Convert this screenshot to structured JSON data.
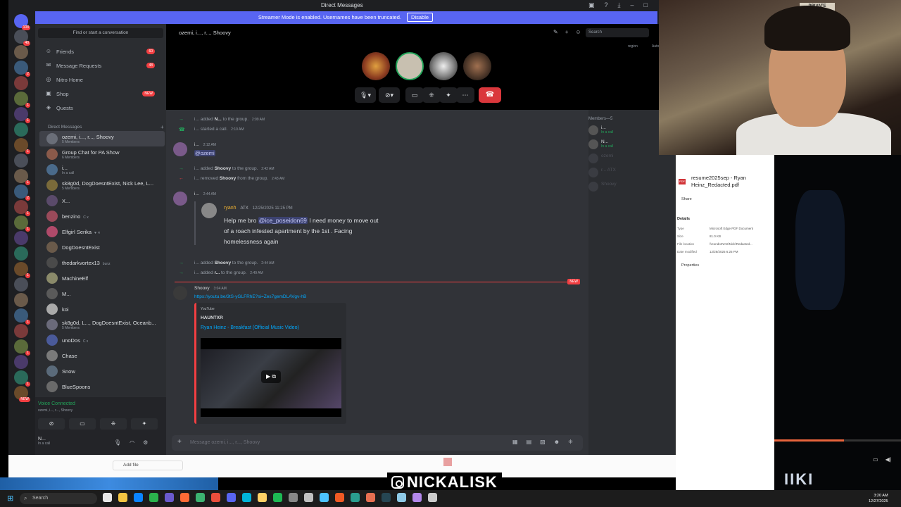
{
  "window": {
    "title": "Direct Messages",
    "streamer_banner": "Streamer Mode is enabled. Usernames have been truncated.",
    "disable_label": "Disable"
  },
  "rail": {
    "home_badge": "108",
    "servers": [
      {
        "badge": "48"
      },
      {
        "badge": ""
      },
      {
        "badge": "2"
      },
      {
        "badge": ""
      },
      {
        "badge": "1"
      },
      {
        "badge": "1"
      },
      {
        "badge": ""
      },
      {
        "badge": "1"
      },
      {
        "badge": ""
      },
      {
        "badge": "1"
      },
      {
        "badge": "2"
      },
      {
        "badge": "1"
      },
      {
        "badge": "1"
      },
      {
        "badge": ""
      },
      {
        "badge": ""
      },
      {
        "badge": "1"
      },
      {
        "badge": ""
      },
      {
        "badge": ""
      },
      {
        "badge": "1"
      },
      {
        "badge": ""
      },
      {
        "badge": "1"
      },
      {
        "badge": ""
      },
      {
        "badge": "1"
      },
      {
        "badge": "NEW"
      }
    ]
  },
  "sidebar": {
    "find_placeholder": "Find or start a conversation",
    "nav": [
      {
        "label": "Friends",
        "badge": "60",
        "icon": "friends-icon"
      },
      {
        "label": "Message Requests",
        "badge": "48",
        "icon": "envelope-icon"
      },
      {
        "label": "Nitro Home",
        "badge": "",
        "icon": "nitro-icon"
      },
      {
        "label": "Shop",
        "badge": "NEW",
        "icon": "shop-icon"
      },
      {
        "label": "Quests",
        "badge": "",
        "icon": "quests-icon"
      }
    ],
    "dm_header": "Direct Messages",
    "dms": [
      {
        "name": "ozemi, i..., r..., Shoovy",
        "sub": "5 Members",
        "tag": ""
      },
      {
        "name": "Group Chat for PA Show",
        "sub": "6 Members",
        "tag": ""
      },
      {
        "name": "i...",
        "sub": "In a call",
        "tag": ""
      },
      {
        "name": "sk8g0d, DogDoesntExist, Nick Lee, L...",
        "sub": "5 Members",
        "tag": ""
      },
      {
        "name": "X...",
        "sub": "",
        "tag": ""
      },
      {
        "name": "benzino",
        "sub": "",
        "tag": "C x"
      },
      {
        "name": "Elfgirl Serika",
        "sub": "",
        "tag": "♥ ✕"
      },
      {
        "name": "DogDoesntExist",
        "sub": "",
        "tag": ""
      },
      {
        "name": "thedarkvortex13",
        "sub": "",
        "tag": "bunz"
      },
      {
        "name": "MachineElf",
        "sub": "",
        "tag": ""
      },
      {
        "name": "M...",
        "sub": "",
        "tag": ""
      },
      {
        "name": "koi",
        "sub": "",
        "tag": ""
      },
      {
        "name": "sk8g0d, L..., DogDoesntExist, Oceanb...",
        "sub": "5 Members",
        "tag": ""
      },
      {
        "name": "unoDos",
        "sub": "",
        "tag": "C x"
      },
      {
        "name": "Chase",
        "sub": "",
        "tag": ""
      },
      {
        "name": "Snow",
        "sub": "",
        "tag": ""
      },
      {
        "name": "BlueSpoons",
        "sub": "",
        "tag": ""
      }
    ],
    "voice": {
      "status": "Voice Connected",
      "channel": "ozemi, i..., r..., Shoovy"
    },
    "user": {
      "name": "N...",
      "status": "In a call"
    }
  },
  "chat": {
    "title": "ozemi, i..., r..., Shoovy",
    "search_placeholder": "Search",
    "region_label": "region",
    "auto_label": "Autom",
    "composer_placeholder": "Message ozemi, i..., r..., Shoovy",
    "messages": {
      "sys1": {
        "actor": "i...",
        "text": "added",
        "target": "N...",
        "rest": "to the group.",
        "time": "2:09 AM"
      },
      "sys2": {
        "actor": "i...",
        "text": "started a call.",
        "time": "2:10 AM"
      },
      "m1": {
        "author": "i...",
        "time": "2:12 AM",
        "mention": "@ozemi"
      },
      "sys3": {
        "actor": "i...",
        "text": "added",
        "target": "Shoovy",
        "rest": "to the group.",
        "time": "2:42 AM"
      },
      "sys4": {
        "actor": "i...",
        "text": "removed",
        "target": "Shoovy",
        "rest": "from the group.",
        "time": "2:43 AM"
      },
      "m2": {
        "author": "i...",
        "time": "2:44 AM"
      },
      "forward": {
        "name": "ryanh",
        "tag": "ATX",
        "date": "12/25/2025 11:25 PM",
        "text_pre": "Help me bro",
        "mention": "@ice_poseidon69",
        "text_post": "I need money to move out of a roach infested apartment by the 1st . Facing homelessness again"
      },
      "sys5": {
        "actor": "i...",
        "text": "added",
        "target": "Shoovy",
        "rest": "to the group.",
        "time": "2:44 AM"
      },
      "sys6": {
        "actor": "i...",
        "text": "added",
        "target": "r...",
        "rest": "to the group.",
        "time": "2:49 AM"
      },
      "new_label": "NEW",
      "m3": {
        "author": "Shoovy",
        "time": "3:04 AM",
        "link": "https://youtu.be/3tS-yGLFRhE?si=Zes7gemDLAVgv-hB",
        "embed": {
          "provider": "YouTube",
          "channel": "HAUNTXR",
          "title": "Ryan Heinz - Breakfast (Official Music Video)"
        }
      }
    }
  },
  "members": {
    "header": "Members—5",
    "list": [
      {
        "name": "i...",
        "status": "In a call",
        "dim": false
      },
      {
        "name": "N...",
        "status": "In a call",
        "dim": false
      },
      {
        "name": "ozemi",
        "status": "",
        "dim": true
      },
      {
        "name": "r... ATX",
        "status": "",
        "dim": true
      },
      {
        "name": "Shoovy",
        "status": "",
        "dim": true
      }
    ]
  },
  "file_panel": {
    "filename": "resume2025sep - Ryan Heinz_Redacted.pdf",
    "share_label": "Share",
    "details_label": "Details",
    "rows": [
      {
        "k": "Type",
        "v": "Microsoft Edge PDF Document"
      },
      {
        "k": "Size",
        "v": "81.0 KB"
      },
      {
        "k": "File location",
        "v": "\\\\CondorNAS\\Nick\\Redacted..."
      },
      {
        "k": "Date modified",
        "v": "12/26/2025 6:25 PM"
      }
    ],
    "properties_label": "Properties"
  },
  "lower_window": {
    "add_file_label": "Add file"
  },
  "webcam": {
    "sign_text": "PRIVATE PROPERTY"
  },
  "video": {
    "watermark": "IIKI",
    "progress": 0.55
  },
  "overlay": {
    "handle": "NICKALISK"
  },
  "taskbar": {
    "search_placeholder": "Search",
    "time": "3:20 AM",
    "date": "12/27/2025",
    "app_colors": [
      "#e8e8e8",
      "#f4c542",
      "#0a84ff",
      "#2bb24c",
      "#6a5acd",
      "#ff6b35",
      "#3cb371",
      "#e94e3c",
      "#5865f2",
      "#00b4d8",
      "#ffd166",
      "#1db954",
      "#888888",
      "#c0c0c0",
      "#4cc2ff",
      "#f15a24",
      "#2a9d8f",
      "#e76f51",
      "#264653",
      "#8ecae6",
      "#b388eb",
      "#cccccc"
    ]
  },
  "colors": {
    "blurple": "#5865f2",
    "danger": "#da373c",
    "online": "#23a55a",
    "link": "#00a8fc"
  }
}
